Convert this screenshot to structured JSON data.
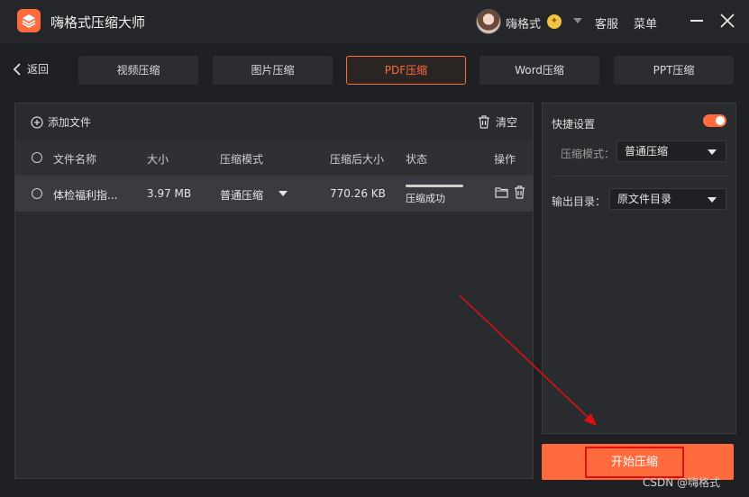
{
  "app": {
    "title": "嗨格式压缩大师",
    "username": "嗨格式",
    "service_label": "客服",
    "menu_label": "菜单"
  },
  "nav": {
    "back_label": "返回",
    "tabs": [
      {
        "label": "视频压缩",
        "active": false
      },
      {
        "label": "图片压缩",
        "active": false
      },
      {
        "label": "PDF压缩",
        "active": true
      },
      {
        "label": "Word压缩",
        "active": false
      },
      {
        "label": "PPT压缩",
        "active": false
      }
    ]
  },
  "toolbar": {
    "add_file_label": "添加文件",
    "clear_label": "清空"
  },
  "table": {
    "headers": {
      "name": "文件名称",
      "size": "大小",
      "mode": "压缩模式",
      "compressed_size": "压缩后大小",
      "status": "状态",
      "actions": "操作"
    },
    "rows": [
      {
        "name": "体检福利指...",
        "size": "3.97 MB",
        "mode": "普通压缩",
        "compressed_size": "770.26 KB",
        "status": "压缩成功",
        "progress": 1.0
      }
    ]
  },
  "settings": {
    "quick_label": "快捷设置",
    "quick_enabled": true,
    "mode_label": "压缩模式：",
    "mode_value": "普通压缩",
    "output_label": "输出目录：",
    "output_value": "原文件目录"
  },
  "start_button": {
    "label": "开始压缩"
  },
  "watermark": "CSDN @嗨格式",
  "colors": {
    "accent": "#ff6b3d",
    "annotation": "#e01010",
    "background": "#1f2023",
    "panel": "#2a2b2f"
  }
}
